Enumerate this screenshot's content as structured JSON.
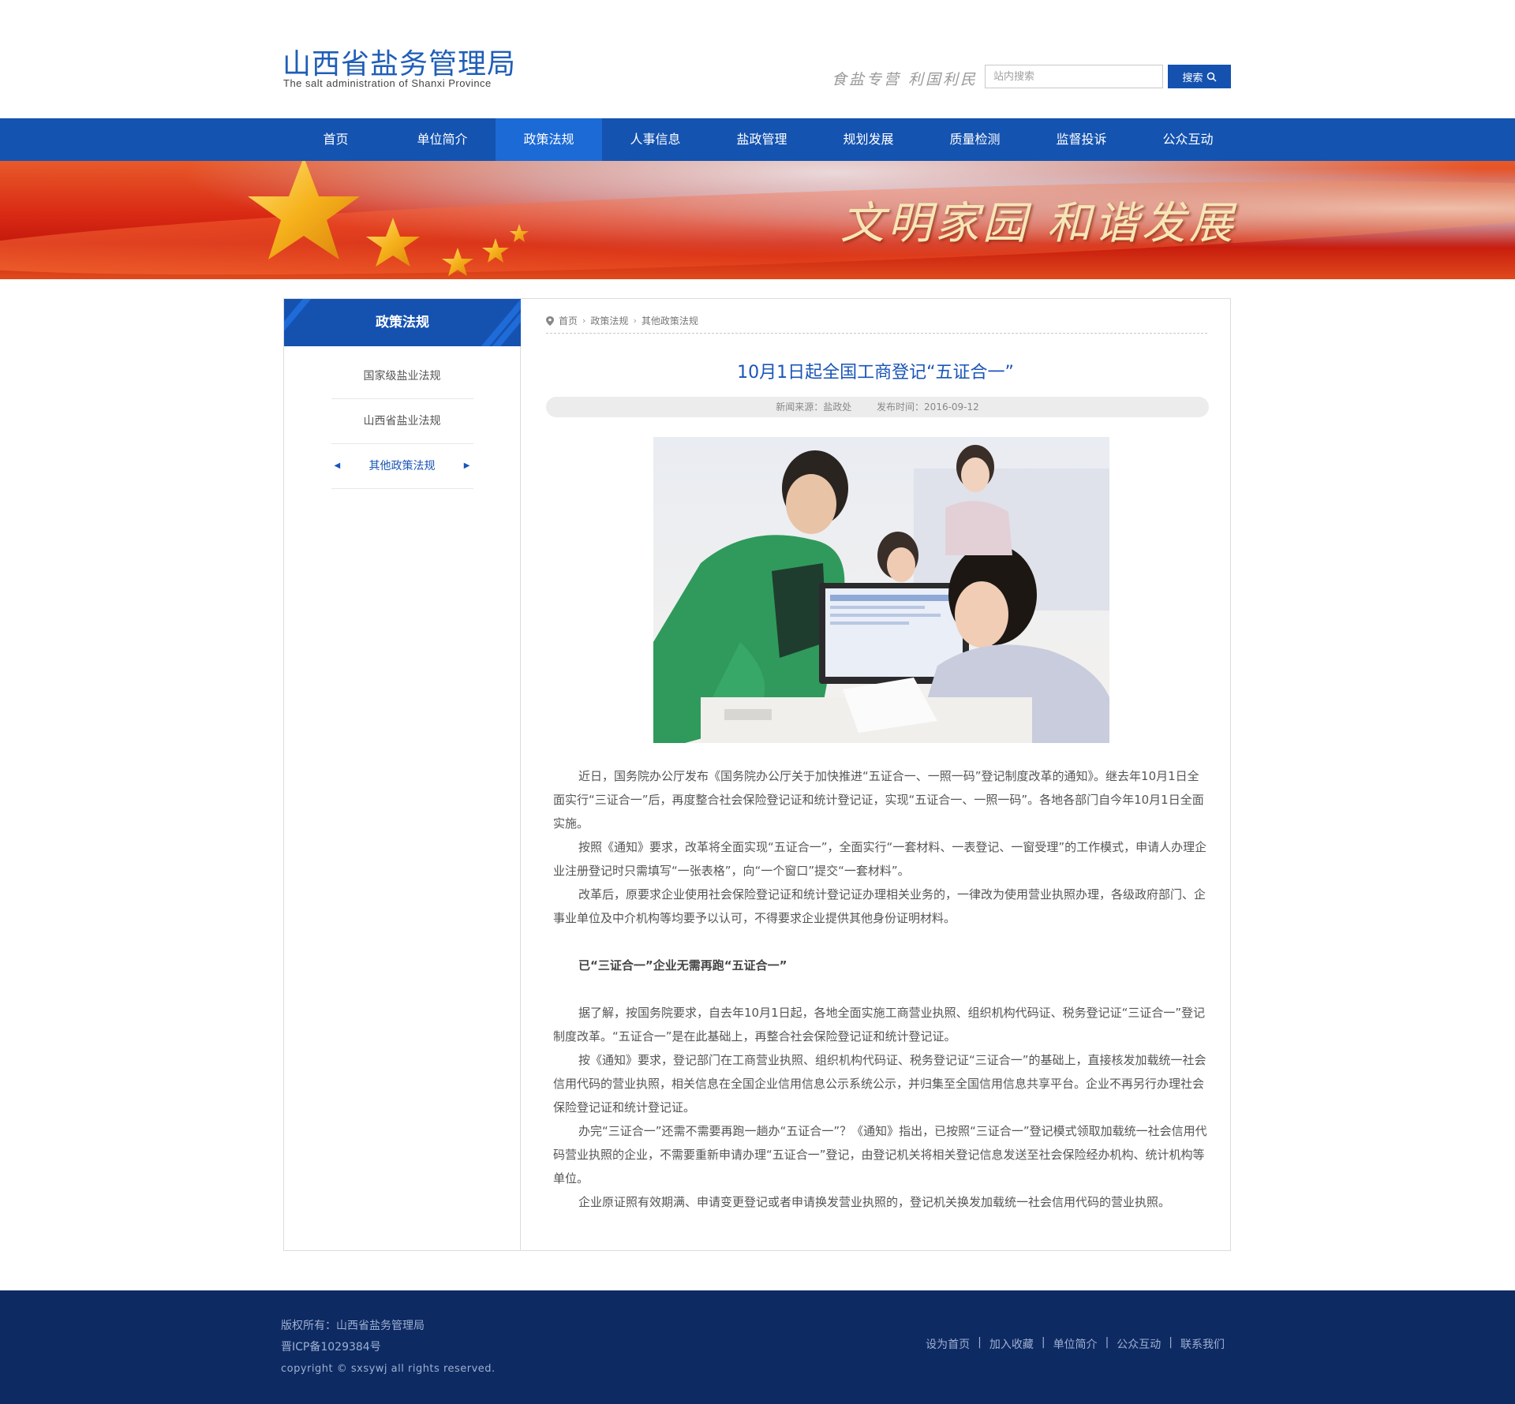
{
  "header": {
    "logo_cn": "山西省盐务管理局",
    "logo_en": "The salt administration of Shanxi Province",
    "slogan": "食盐专营 利国利民",
    "search_placeholder": "站内搜索",
    "search_button": "搜索"
  },
  "nav": {
    "items": [
      "首页",
      "单位简介",
      "政策法规",
      "人事信息",
      "盐政管理",
      "规划发展",
      "质量检测",
      "监督投诉",
      "公众互动"
    ],
    "active": "政策法规"
  },
  "banner": {
    "text": "文明家园  和谐发展"
  },
  "sidebar": {
    "title": "政策法规",
    "items": [
      "国家级盐业法规",
      "山西省盐业法规",
      "其他政策法规"
    ],
    "active": "其他政策法规"
  },
  "breadcrumb": [
    "首页",
    "政策法规",
    "其他政策法规"
  ],
  "article": {
    "title": "10月1日起全国工商登记“五证合一”",
    "source": "新闻来源：盐政处",
    "date": "发布时间：2016-09-12",
    "paragraphs": [
      "近日，国务院办公厅发布《国务院办公厅关于加快推进“五证合一、一照一码”登记制度改革的通知》。继去年10月1日全面实行“三证合一”后，再度整合社会保险登记证和统计登记证，实现“五证合一、一照一码”。各地各部门自今年10月1日全面实施。",
      "按照《通知》要求，改革将全面实现“五证合一”，全面实行“一套材料、一表登记、一窗受理”的工作模式，申请人办理企业注册登记时只需填写“一张表格”，向“一个窗口”提交“一套材料”。",
      "改革后，原要求企业使用社会保险登记证和统计登记证办理相关业务的，一律改为使用营业执照办理，各级政府部门、企事业单位及中介机构等均要予以认可，不得要求企业提供其他身份证明材料。",
      "",
      "已“三证合一”企业无需再跑“五证合一”",
      "",
      "据了解，按国务院要求，自去年10月1日起，各地全面实施工商营业执照、组织机构代码证、税务登记证“三证合一”登记制度改革。“五证合一”是在此基础上，再整合社会保险登记证和统计登记证。",
      "按《通知》要求，登记部门在工商营业执照、组织机构代码证、税务登记证“三证合一”的基础上，直接核发加载统一社会信用代码的营业执照，相关信息在全国企业信用信息公示系统公示，并归集至全国信用信息共享平台。企业不再另行办理社会保险登记证和统计登记证。",
      "办完“三证合一”还需不需要再跑一趟办“五证合一”？《通知》指出，已按照“三证合一”登记模式领取加载统一社会信用代码营业执照的企业，不需要重新申请办理“五证合一”登记，由登记机关将相关登记信息发送至社会保险经办机构、统计机构等单位。",
      "企业原证照有效期满、申请变更登记或者申请换发营业执照的，登记机关换发加载统一社会信用代码的营业执照。"
    ]
  },
  "footer": {
    "copyright": "版权所有：山西省盐务管理局",
    "icp": "晋ICP备1029384号",
    "rights": "copyright © sxsywj all rights reserved.",
    "links": [
      "设为首页",
      "加入收藏",
      "单位简介",
      "公众互动",
      "联系我们"
    ]
  },
  "colors": {
    "brand_blue": "#1453b0",
    "nav_active": "#1b6ad6",
    "footer_bg": "#0d2a63",
    "title_blue": "#1a55b8"
  },
  "icons": {
    "search": "search-icon",
    "location": "location-pin-icon",
    "breadcrumb_sep": "chevron-right-icon",
    "side_left": "caret-left-icon",
    "side_right": "caret-right-icon"
  }
}
